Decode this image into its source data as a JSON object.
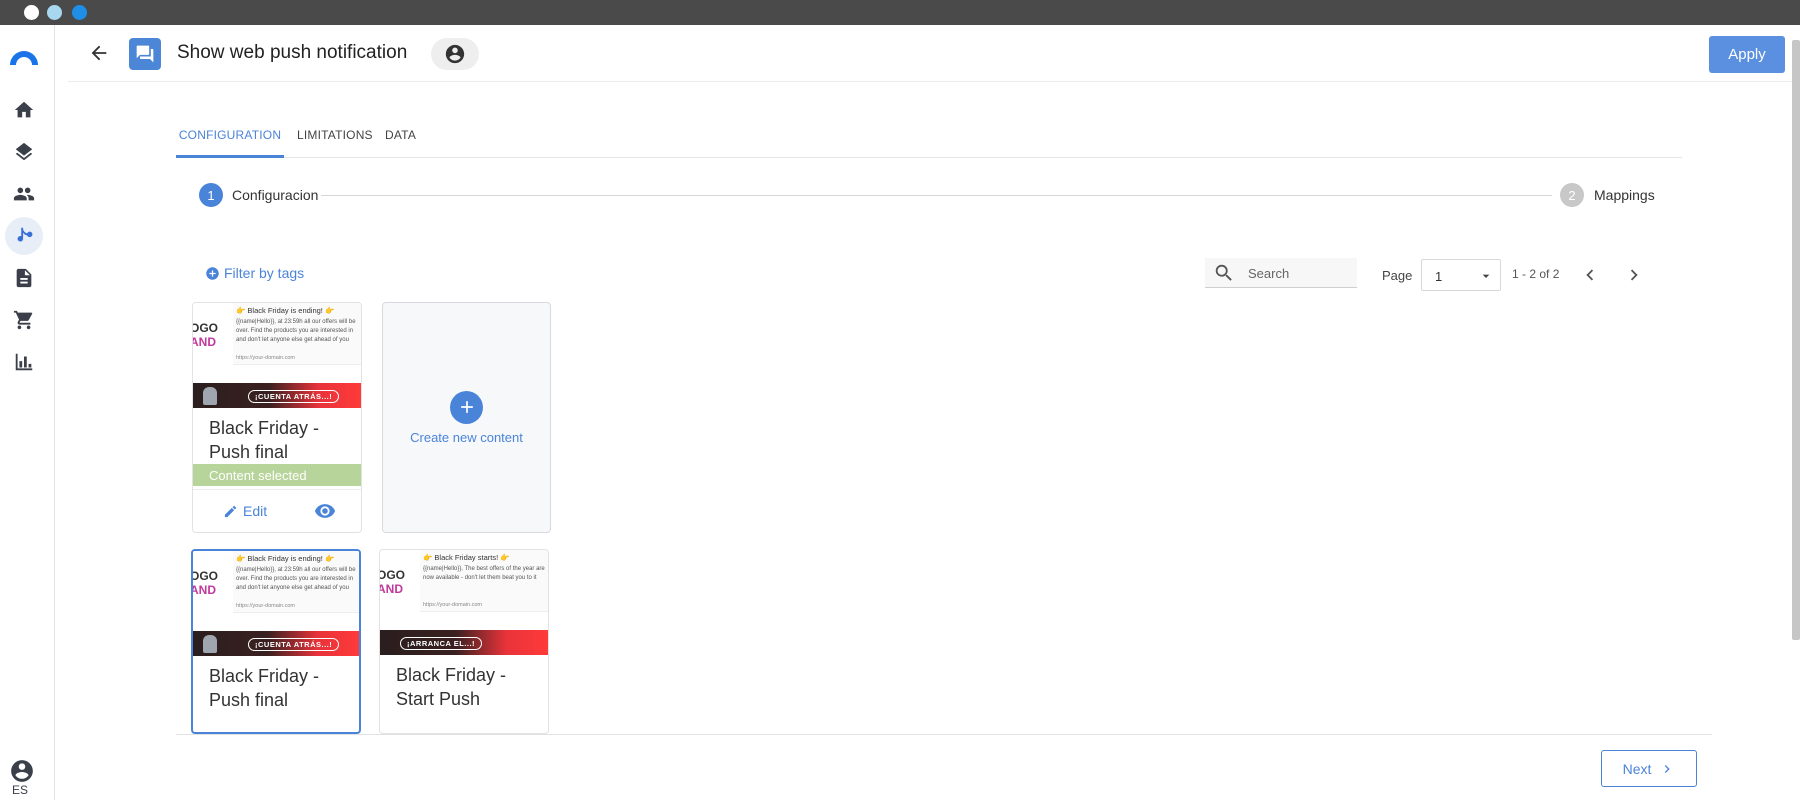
{
  "header": {
    "title": "Show web push notification",
    "apply_label": "Apply"
  },
  "sidebar": {
    "items": [
      {
        "icon": "home-icon"
      },
      {
        "icon": "layers-icon"
      },
      {
        "icon": "people-icon"
      },
      {
        "icon": "workflow-icon",
        "active": true
      },
      {
        "icon": "document-icon"
      },
      {
        "icon": "cart-icon"
      },
      {
        "icon": "chart-icon"
      }
    ],
    "language": "ES"
  },
  "tabs": [
    {
      "label": "CONFIGURATION",
      "active": true
    },
    {
      "label": "LIMITATIONS"
    },
    {
      "label": "DATA"
    }
  ],
  "stepper": {
    "steps": [
      {
        "number": "1",
        "label": "Configuracion",
        "active": true
      },
      {
        "number": "2",
        "label": "Mappings"
      }
    ]
  },
  "toolbar": {
    "filter_label": "Filter by tags",
    "search_placeholder": "Search",
    "page_label": "Page",
    "page_value": "1",
    "range_label": "1 - 2 of 2"
  },
  "cards": [
    {
      "title_line1": "Black Friday -",
      "title_line2": "Push final",
      "push_title": "👉 Black Friday is ending! 👉",
      "push_body": "{{name|Hello}}, at 23:59h all our offers will be over. Find the products you are interested in and don't let anyone else get ahead of you",
      "push_url": "https://your-domain.com",
      "logo_l1": "OGO",
      "logo_l2": "AND",
      "banner_text": "¡CUENTA ATRÁS...!",
      "selected_label": "Content selected",
      "edit_label": "Edit"
    },
    {
      "title_line1": "Black Friday -",
      "title_line2": "Push final",
      "push_title": "👉 Black Friday is ending! 👉",
      "push_body": "{{name|Hello}}, at 23:59h all our offers will be over. Find the products you are interested in and don't let anyone else get ahead of you",
      "push_url": "https://your-domain.com",
      "logo_l1": "OGO",
      "logo_l2": "AND",
      "banner_text": "¡CUENTA ATRÁS...!"
    },
    {
      "title_line1": "Black Friday -",
      "title_line2": "Start Push",
      "push_title": "👉 Black Friday starts! 👉",
      "push_body": "{{name|Hello}}, The best offers of the year are now available - don't let them beat you to it",
      "push_url": "https://your-domain.com",
      "logo_l1": "OGO",
      "logo_l2": "AND",
      "banner_text": "¡ARRANCA EL...!"
    }
  ],
  "create_card": {
    "label": "Create new content"
  },
  "footer": {
    "next_label": "Next"
  },
  "colors": {
    "accent": "#4a84d8",
    "apply_bg": "#5b8fe0",
    "selected_bar": "#b7d49a"
  }
}
